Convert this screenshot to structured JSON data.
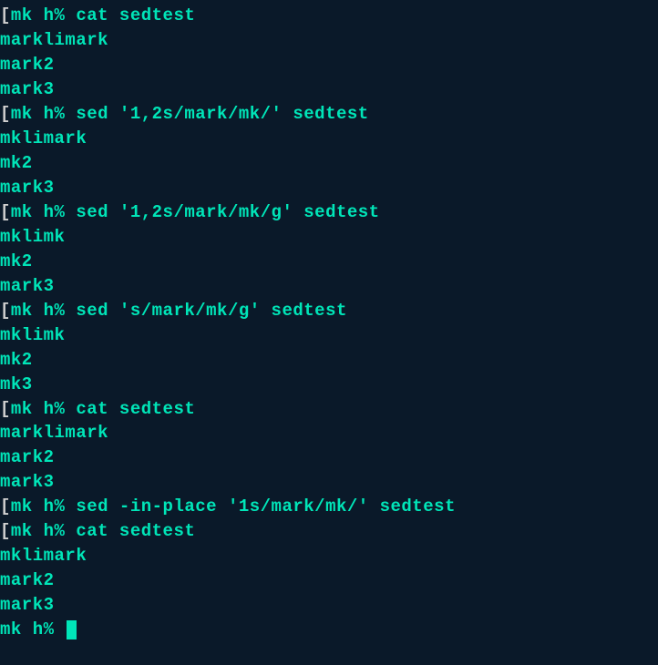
{
  "lines": [
    {
      "type": "prompt",
      "prompt": "mk h%",
      "command": "cat sedtest"
    },
    {
      "type": "output",
      "text": "marklimark"
    },
    {
      "type": "output",
      "text": "mark2"
    },
    {
      "type": "output",
      "text": "mark3"
    },
    {
      "type": "prompt",
      "prompt": "mk h%",
      "command": "sed '1,2s/mark/mk/' sedtest"
    },
    {
      "type": "output",
      "text": "mklimark"
    },
    {
      "type": "output",
      "text": "mk2"
    },
    {
      "type": "output",
      "text": "mark3"
    },
    {
      "type": "prompt",
      "prompt": "mk h%",
      "command": "sed '1,2s/mark/mk/g' sedtest"
    },
    {
      "type": "output",
      "text": "mklimk"
    },
    {
      "type": "output",
      "text": "mk2"
    },
    {
      "type": "output",
      "text": "mark3"
    },
    {
      "type": "prompt",
      "prompt": "mk h%",
      "command": "sed 's/mark/mk/g' sedtest"
    },
    {
      "type": "output",
      "text": "mklimk"
    },
    {
      "type": "output",
      "text": "mk2"
    },
    {
      "type": "output",
      "text": "mk3"
    },
    {
      "type": "prompt",
      "prompt": "mk h%",
      "command": "cat sedtest"
    },
    {
      "type": "output",
      "text": "marklimark"
    },
    {
      "type": "output",
      "text": "mark2"
    },
    {
      "type": "output",
      "text": "mark3"
    },
    {
      "type": "prompt",
      "prompt": "mk h%",
      "command": "sed -in-place '1s/mark/mk/' sedtest"
    },
    {
      "type": "prompt",
      "prompt": "mk h%",
      "command": "cat sedtest"
    },
    {
      "type": "output",
      "text": "mklimark"
    },
    {
      "type": "output",
      "text": "mark2"
    },
    {
      "type": "output",
      "text": "mark3"
    },
    {
      "type": "cursor",
      "prompt": "mk h%"
    }
  ],
  "bracket": "["
}
